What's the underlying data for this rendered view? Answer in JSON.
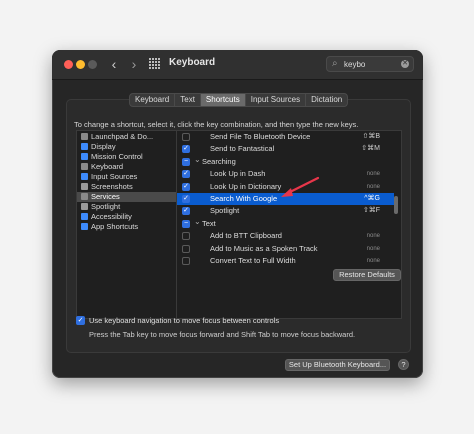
{
  "window": {
    "title": "Keyboard",
    "search_value": "keybo",
    "icons": {
      "back": "chevron-left-icon",
      "forward": "chevron-right-icon",
      "grid": "grid-icon",
      "search": "search-icon",
      "clear": "clear-icon"
    }
  },
  "tabs": [
    {
      "label": "Keyboard",
      "active": false
    },
    {
      "label": "Text",
      "active": false
    },
    {
      "label": "Shortcuts",
      "active": true
    },
    {
      "label": "Input Sources",
      "active": false
    },
    {
      "label": "Dictation",
      "active": false
    }
  ],
  "instruction": "To change a shortcut, select it, click the key combination, and then type the new keys.",
  "categories": [
    {
      "label": "Launchpad & Do...",
      "icon": "launchpad-icon",
      "color": "#8a8a8a"
    },
    {
      "label": "Display",
      "icon": "display-icon",
      "color": "#3d8bfd"
    },
    {
      "label": "Mission Control",
      "icon": "mission-control-icon",
      "color": "#3d8bfd"
    },
    {
      "label": "Keyboard",
      "icon": "keyboard-icon",
      "color": "#8a8a8a"
    },
    {
      "label": "Input Sources",
      "icon": "input-sources-icon",
      "color": "#3d8bfd"
    },
    {
      "label": "Screenshots",
      "icon": "screenshots-icon",
      "color": "#9a9a9a"
    },
    {
      "label": "Services",
      "icon": "services-gear-icon",
      "color": "#8a8a8a",
      "selected": true
    },
    {
      "label": "Spotlight",
      "icon": "spotlight-icon",
      "color": "#9a9a9a"
    },
    {
      "label": "Accessibility",
      "icon": "accessibility-icon",
      "color": "#3d8bfd"
    },
    {
      "label": "App Shortcuts",
      "icon": "app-shortcuts-icon",
      "color": "#3d8bfd"
    }
  ],
  "shortcuts": [
    {
      "kind": "item",
      "label": "Send File To Bluetooth Device",
      "key": "⇧⌘B",
      "checked": false
    },
    {
      "kind": "item",
      "label": "Send to Fantastical",
      "key": "⇧⌘M",
      "checked": true
    },
    {
      "kind": "group",
      "label": "Searching"
    },
    {
      "kind": "item",
      "label": "Look Up in Dash",
      "key": "none",
      "checked": true
    },
    {
      "kind": "item",
      "label": "Look Up in Dictionary",
      "key": "none",
      "checked": true
    },
    {
      "kind": "item",
      "label": "Search With Google",
      "key": "^⌘G",
      "checked": true,
      "selected": true
    },
    {
      "kind": "item",
      "label": "Spotlight",
      "key": "⇧⌘F",
      "checked": true
    },
    {
      "kind": "group",
      "label": "Text"
    },
    {
      "kind": "item",
      "label": "Add to BTT Clipboard",
      "key": "none",
      "checked": false
    },
    {
      "kind": "item",
      "label": "Add to Music as a Spoken Track",
      "key": "none",
      "checked": false
    },
    {
      "kind": "item",
      "label": "Convert Text to Full Width",
      "key": "none",
      "checked": false
    }
  ],
  "restore_defaults": "Restore Defaults",
  "keyboard_navigation": {
    "label": "Use keyboard navigation to move focus between controls",
    "checked": true,
    "description": "Press the Tab key to move focus forward and Shift Tab to move focus backward."
  },
  "bluetooth_button": "Set Up Bluetooth Keyboard...",
  "help_button": "?",
  "colors": {
    "accent": "#2f6fe0",
    "selection": "#0a5ccf",
    "annotation_arrow": "#e8364a"
  }
}
